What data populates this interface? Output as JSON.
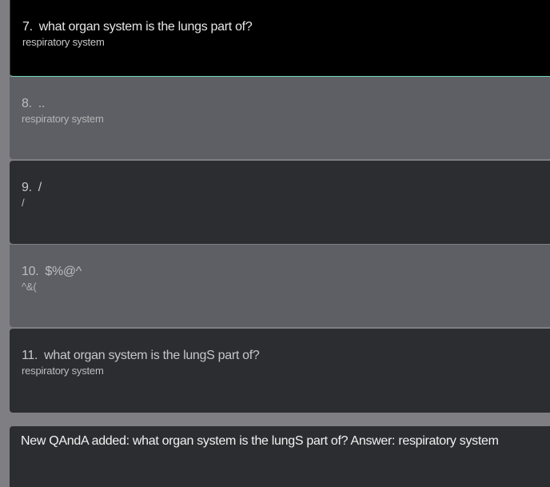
{
  "qa_items": [
    {
      "number": "7.",
      "question": "what organ system is the lungs part of?",
      "answer": "respiratory system"
    },
    {
      "number": "8.",
      "question": "..",
      "answer": "respiratory system"
    },
    {
      "number": "9.",
      "question": "/",
      "answer": "/"
    },
    {
      "number": "10.",
      "question": "$%@^",
      "answer": "^&("
    },
    {
      "number": "11.",
      "question": "what organ system is the lungS part of?",
      "answer": "respiratory system"
    }
  ],
  "toast": {
    "message": "New QAndA added: what organ system is the lungS part of? Answer: respiratory system"
  },
  "colors": {
    "selected_bg": "#000000",
    "selected_accent": "#6fd6b4",
    "light_card_bg": "#5e5f64",
    "dark_card_bg": "#2c2d31",
    "page_bg": "#7f7f83"
  }
}
